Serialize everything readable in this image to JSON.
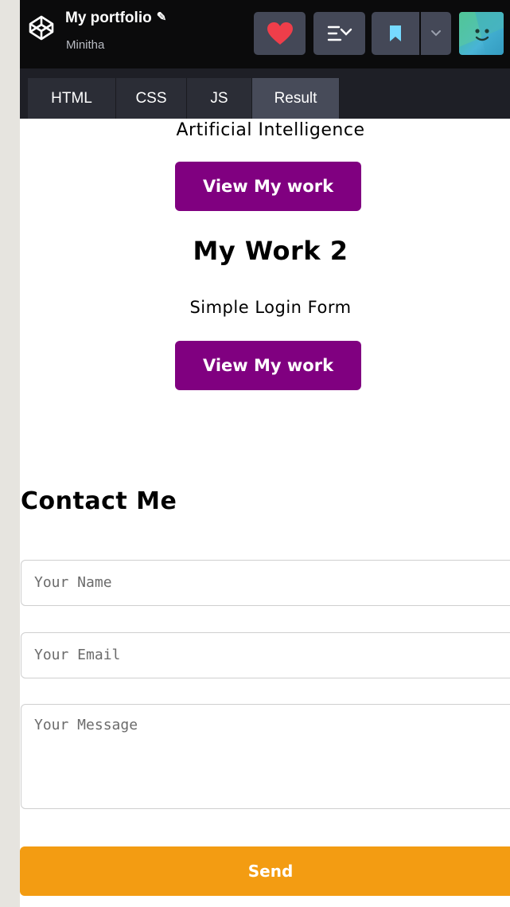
{
  "header": {
    "title": "My portfolio",
    "author": "Minitha",
    "pencil_glyph": "✎"
  },
  "tabs": [
    {
      "label": "HTML"
    },
    {
      "label": "CSS"
    },
    {
      "label": "JS"
    },
    {
      "label": "Result"
    }
  ],
  "result": {
    "work1_description": "Artificial Intelligence",
    "view_work_label_1": "View My work",
    "work2_title": "My Work 2",
    "work2_description": "Simple Login Form",
    "view_work_label_2": "View My work",
    "contact_title": "Contact Me",
    "name_placeholder": "Your Name",
    "email_placeholder": "Your Email",
    "message_placeholder": "Your Message",
    "send_label": "Send"
  },
  "icons": {
    "logo": "codepen-logo-icon",
    "heart": "heart-icon",
    "layout": "layout-icon",
    "bookmark": "bookmark-icon",
    "dropdown": "chevron-down-icon",
    "avatar": "avatar"
  },
  "colors": {
    "header_bg": "#0b0b0c",
    "button_bg": "#444857",
    "heart": "#ef3e4a",
    "bookmark": "#76daff",
    "work_button": "#800080",
    "send_button": "#f39c12",
    "active_tab": "#474b59"
  }
}
